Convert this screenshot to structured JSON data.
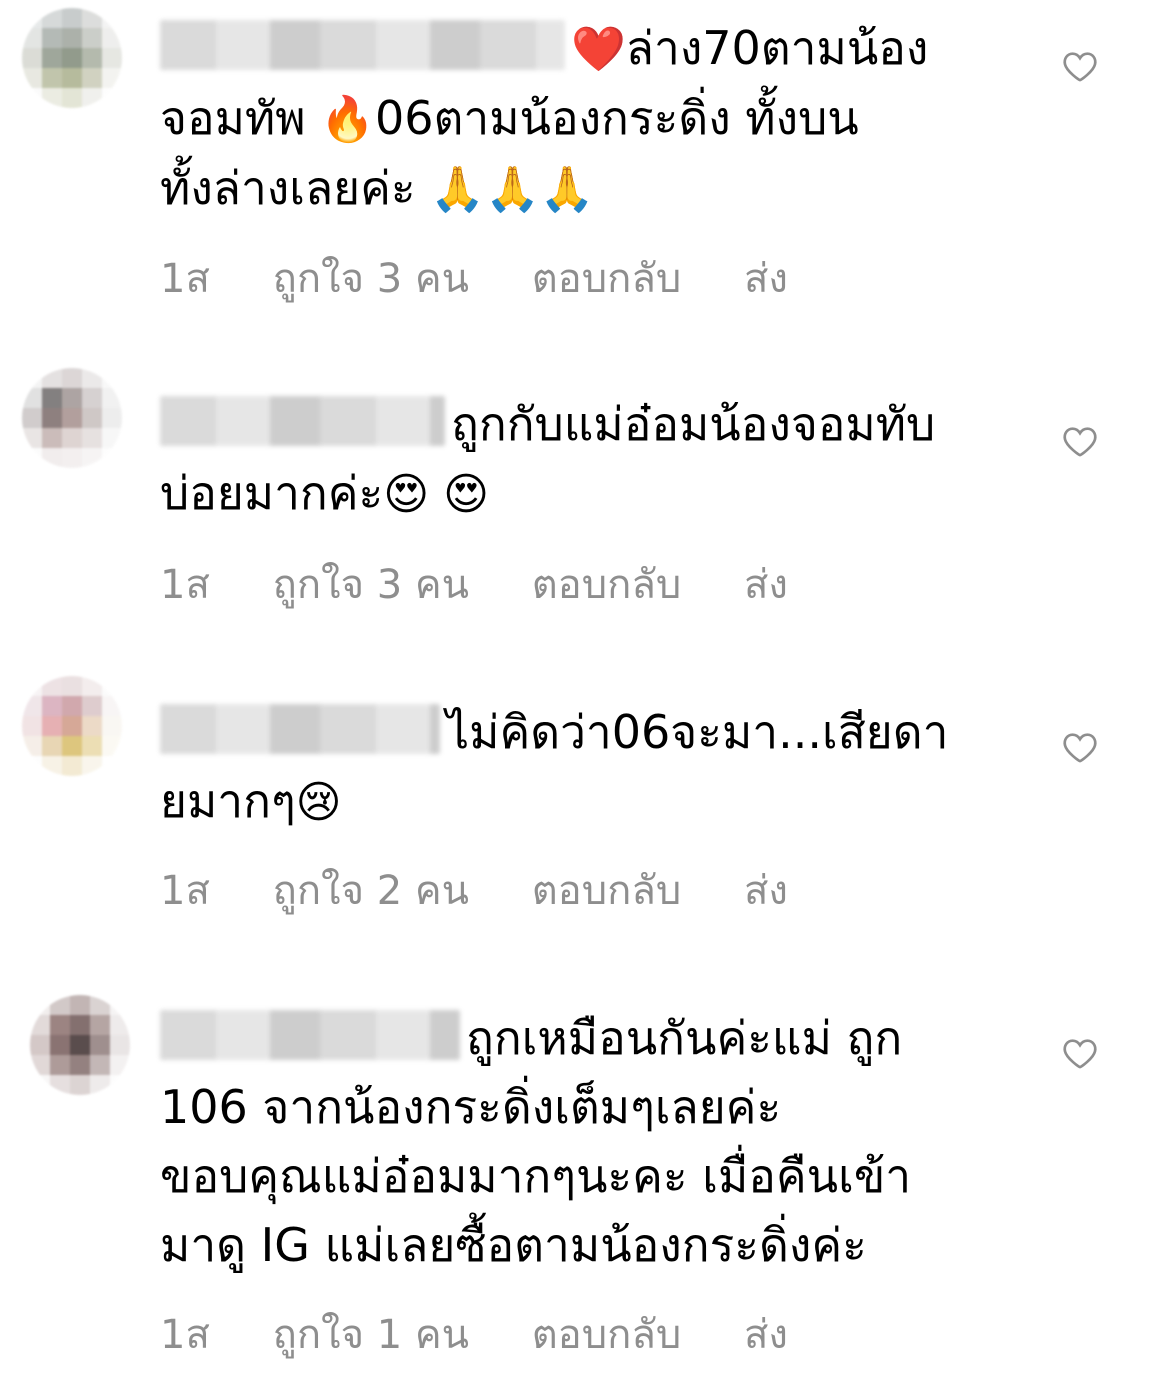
{
  "comments": [
    {
      "text": "ล่าง70ตามน้องจอมทัพ 06ตามน้องกระดิ่ง ทั้งบนทั้งล่างเลยค่ะ",
      "emoji_lead": "❤️",
      "part1": "ล่าง70ตามน้อง",
      "part2": "จอมทัพ ",
      "emoji_mid": "🔥",
      "part3": "06ตามน้องกระดิ่ง ทั้งบน",
      "part4": "ทั้งล่างเลยค่ะ ",
      "emoji_end": "🙏🙏🙏",
      "time": "1ส",
      "likes": "ถูกใจ 3 คน",
      "reply": "ตอบกลับ",
      "send": "ส่ง"
    },
    {
      "part1": "ถูกกับแม่อ๋อมน้องจอมทับ",
      "part2": "บ่อยมากค่ะ",
      "emoji_end": "😍 😍",
      "time": "1ส",
      "likes": "ถูกใจ 3 คน",
      "reply": "ตอบกลับ",
      "send": "ส่ง"
    },
    {
      "part1": "ไม่คิดว่า06จะมา...เสียดา",
      "part2": "ยมากๆ",
      "emoji_end": "😢",
      "time": "1ส",
      "likes": "ถูกใจ 2 คน",
      "reply": "ตอบกลับ",
      "send": "ส่ง"
    },
    {
      "part1": "ถูกเหมือนกันค่ะแม่ ถูก",
      "part2": "106 จากน้องกระดิ่งเต็มๆเลยค่ะ",
      "part3": "ขอบคุณแม่อ๋อมมากๆนะคะ เมื่อคืนเข้า",
      "part4": "มาดู IG แม่เลยซื้อตามน้องกระดิ่งค่ะ",
      "time": "1ส",
      "likes": "ถูกใจ 1 คน",
      "reply": "ตอบกลับ",
      "send": "ส่ง"
    }
  ],
  "icons": {
    "like": "heart-outline-icon"
  },
  "colors": {
    "meta": "#8e8e8e",
    "text": "#000000"
  }
}
